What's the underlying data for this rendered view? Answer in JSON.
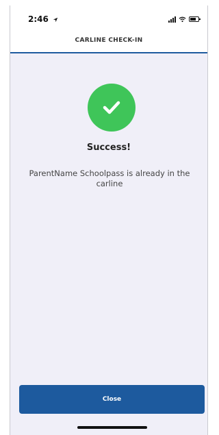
{
  "status_bar": {
    "time": "2:46",
    "icons": [
      "location-arrow-icon",
      "signal-icon",
      "wifi-icon",
      "battery-icon"
    ]
  },
  "header": {
    "title": "CARLINE CHECK-IN"
  },
  "content": {
    "icon": "checkmark-icon",
    "heading": "Success!",
    "message": "ParentName Schoolpass is already in the carline"
  },
  "footer": {
    "close_label": "Close"
  },
  "colors": {
    "brand_blue": "#1d5a9e",
    "success_green": "#3fc559",
    "background": "#f0eff8"
  }
}
